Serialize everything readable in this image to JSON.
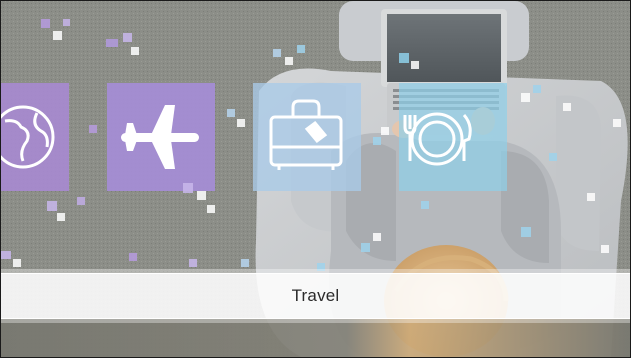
{
  "caption": {
    "text": "Travel"
  },
  "icons": [
    "globe-icon",
    "airplane-icon",
    "luggage-icon",
    "dining-icon"
  ],
  "colors": {
    "purple_tile": "#a78ad2",
    "blue_tile": "#a9cbe8",
    "cyan_tile": "#8fd0ea",
    "carpet": "#8a8c86"
  }
}
